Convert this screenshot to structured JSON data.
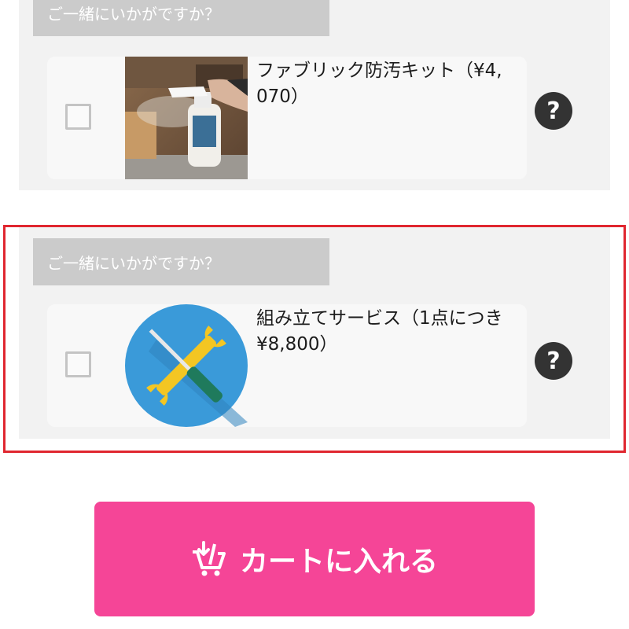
{
  "upsell_sections": [
    {
      "header": "ご一緒にいかがですか？",
      "product_name": "ファブリック防汚キット（¥4,\n070）",
      "image": "fabric-spray-photo",
      "help_icon": "question-icon"
    },
    {
      "header": "ご一緒にいかがですか？",
      "product_name": "組み立てサービス（1点につき\n¥8,800）",
      "image": "tools-icon",
      "help_icon": "question-icon"
    }
  ],
  "cart_button": {
    "label": "カートに入れる",
    "icon": "cart-add-icon"
  },
  "help_glyph": "?",
  "colors": {
    "accent": "#f54597",
    "highlight": "#e0262f",
    "header_bg": "#cbcbcb",
    "tools_circle": "#3a9ad9"
  }
}
